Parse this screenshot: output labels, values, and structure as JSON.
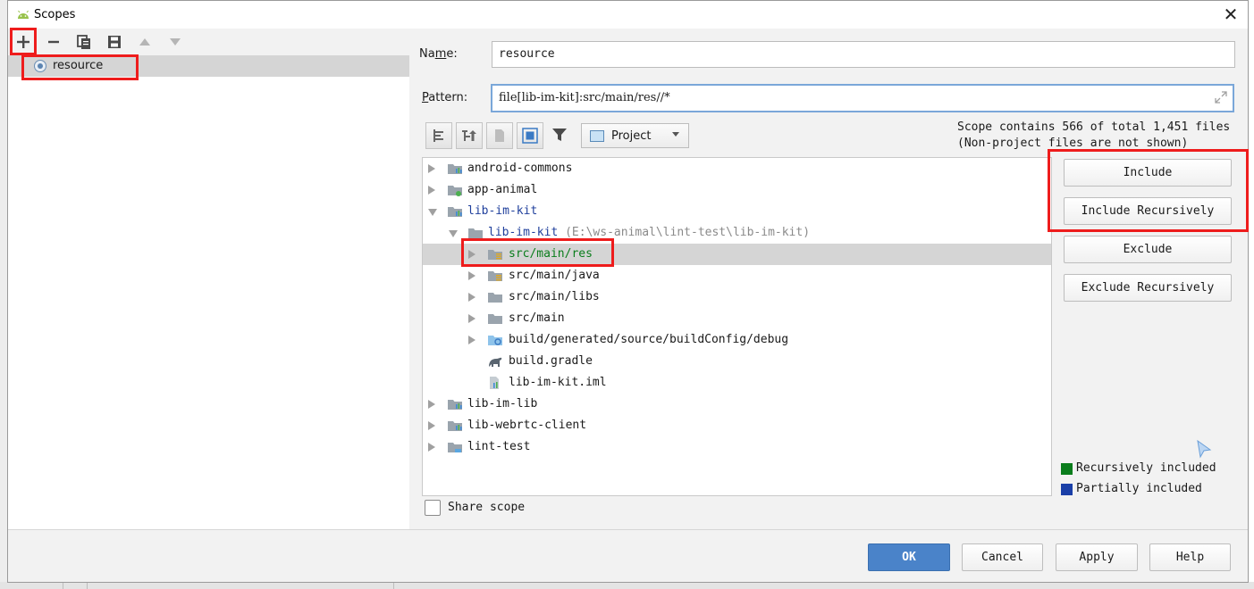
{
  "window": {
    "title": "Scopes",
    "close_glyph": "✕"
  },
  "left_toolbar": {
    "buttons": [
      "add-icon",
      "remove-icon",
      "copy-icon",
      "save-icon",
      "move-up-icon",
      "move-down-icon"
    ]
  },
  "scopes": [
    {
      "label": "resource",
      "selected": true
    }
  ],
  "form": {
    "name_label_pre": "Na",
    "name_label_mn": "m",
    "name_label_post": "e:",
    "name_value": "resource",
    "pattern_label_pre": "",
    "pattern_label_mn": "P",
    "pattern_label_post": "attern:",
    "pattern_value": "file[lib-im-kit]:src/main/res//*"
  },
  "view": {
    "dropdown_label": "Project",
    "info_line1": "Scope contains 566 of total 1,451 files",
    "info_line2": "(Non-project files are not shown)"
  },
  "tree": [
    {
      "label": "android-commons",
      "level": 0,
      "expandable": true,
      "expanded": false,
      "color": "default",
      "icon": "module-folder-icon"
    },
    {
      "label": "app-animal",
      "level": 0,
      "expandable": true,
      "expanded": false,
      "color": "default",
      "icon": "app-module-folder-icon"
    },
    {
      "label": "lib-im-kit",
      "level": 0,
      "expandable": true,
      "expanded": true,
      "color": "blue",
      "icon": "module-folder-icon"
    },
    {
      "label": "lib-im-kit",
      "path": " (E:\\ws-animal\\lint-test\\lib-im-kit)",
      "level": 1,
      "expandable": true,
      "expanded": true,
      "color": "blue",
      "icon": "folder-icon"
    },
    {
      "label": "src/main/res",
      "level": 2,
      "expandable": true,
      "expanded": false,
      "color": "green",
      "icon": "resource-folder-icon",
      "selected": true
    },
    {
      "label": "src/main/java",
      "level": 2,
      "expandable": true,
      "expanded": false,
      "color": "default",
      "icon": "resource-folder-icon"
    },
    {
      "label": "src/main/libs",
      "level": 2,
      "expandable": true,
      "expanded": false,
      "color": "default",
      "icon": "folder-icon"
    },
    {
      "label": "src/main",
      "level": 2,
      "expandable": true,
      "expanded": false,
      "color": "default",
      "icon": "folder-icon"
    },
    {
      "label": "build/generated/source/buildConfig/debug",
      "level": 2,
      "expandable": true,
      "expanded": false,
      "color": "default",
      "icon": "generated-folder-icon"
    },
    {
      "label": "build.gradle",
      "level": 2,
      "expandable": false,
      "color": "default",
      "icon": "gradle-icon"
    },
    {
      "label": "lib-im-kit.iml",
      "level": 2,
      "expandable": false,
      "color": "default",
      "icon": "iml-file-icon"
    },
    {
      "label": "lib-im-lib",
      "level": 0,
      "expandable": true,
      "expanded": false,
      "color": "default",
      "icon": "module-folder-icon"
    },
    {
      "label": "lib-webrtc-client",
      "level": 0,
      "expandable": true,
      "expanded": false,
      "color": "default",
      "icon": "module-folder-icon"
    },
    {
      "label": "lint-test",
      "level": 0,
      "expandable": true,
      "expanded": false,
      "color": "default",
      "icon": "project-folder-icon"
    }
  ],
  "actions": {
    "include": "Include",
    "include_recursively": "Include Recursively",
    "exclude": "Exclude",
    "exclude_recursively": "Exclude Recursively"
  },
  "legend": [
    {
      "label": "Recursively included",
      "color": "#0a7d1c"
    },
    {
      "label": "Partially included",
      "color": "#1a3fa8"
    }
  ],
  "share_scope": {
    "label": "Share scope",
    "checked": false
  },
  "footer": {
    "ok": "OK",
    "cancel": "Cancel",
    "apply": "Apply",
    "help": "Help"
  },
  "colors": {
    "accent": "#4a83c9",
    "highlight_box": "#ee1c1c",
    "selection": "#d5d5d5"
  }
}
